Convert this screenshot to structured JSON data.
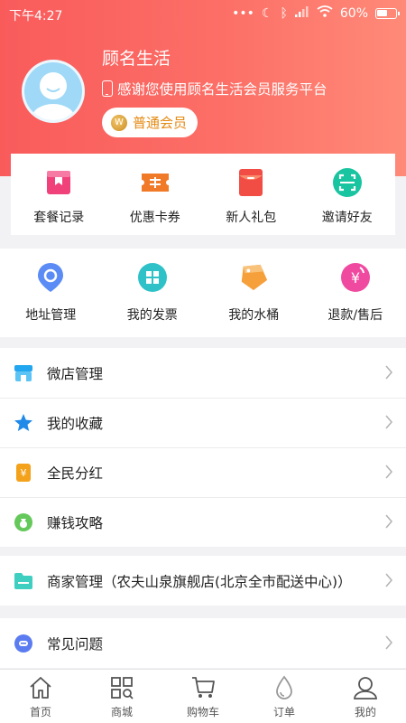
{
  "status_bar": {
    "time": "下午4:27",
    "battery": "60%",
    "battery_level": 0.6
  },
  "profile": {
    "name": "顾名生活",
    "subtitle": "感谢您使用顾名生活会员服务平台",
    "member_level": "普通会员"
  },
  "quick_actions": [
    {
      "label": "套餐记录",
      "icon": "package-record-icon",
      "color": "#f0417a"
    },
    {
      "label": "优惠卡券",
      "icon": "coupon-icon",
      "color": "#f07a28"
    },
    {
      "label": "新人礼包",
      "icon": "gift-pack-icon",
      "color": "#f24d44"
    },
    {
      "label": "邀请好友",
      "icon": "invite-qr-icon",
      "color": "#19c4a0"
    }
  ],
  "services": [
    {
      "label": "地址管理",
      "icon": "location-pin-icon",
      "color": "#5b8cf5"
    },
    {
      "label": "我的发票",
      "icon": "invoice-grid-icon",
      "color": "#2ec2c8"
    },
    {
      "label": "我的水桶",
      "icon": "water-bucket-icon",
      "color": "#f6a03c"
    },
    {
      "label": "退款/售后",
      "icon": "refund-icon",
      "color": "#f04aa0"
    }
  ],
  "menu_group_1": [
    {
      "label": "微店管理",
      "icon": "shop-icon",
      "color": "#22a6ef"
    },
    {
      "label": "我的收藏",
      "icon": "star-icon",
      "color": "#1f8ae8"
    },
    {
      "label": "全民分红",
      "icon": "dividend-icon",
      "color": "#f4a21c"
    },
    {
      "label": "赚钱攻略",
      "icon": "money-bag-icon",
      "color": "#64c85a"
    }
  ],
  "menu_group_2": [
    {
      "label": "商家管理（农夫山泉旗舰店(北京全市配送中心)）",
      "icon": "folder-icon",
      "color": "#3fcfc0"
    }
  ],
  "menu_group_3": [
    {
      "label": "常见问题",
      "icon": "faq-chat-icon",
      "color": "#5b7cf0"
    }
  ],
  "tabbar": [
    {
      "label": "首页",
      "icon": "home-icon"
    },
    {
      "label": "商城",
      "icon": "mall-icon"
    },
    {
      "label": "购物车",
      "icon": "cart-icon"
    },
    {
      "label": "订单",
      "icon": "order-drop-icon"
    },
    {
      "label": "我的",
      "icon": "profile-icon"
    }
  ]
}
